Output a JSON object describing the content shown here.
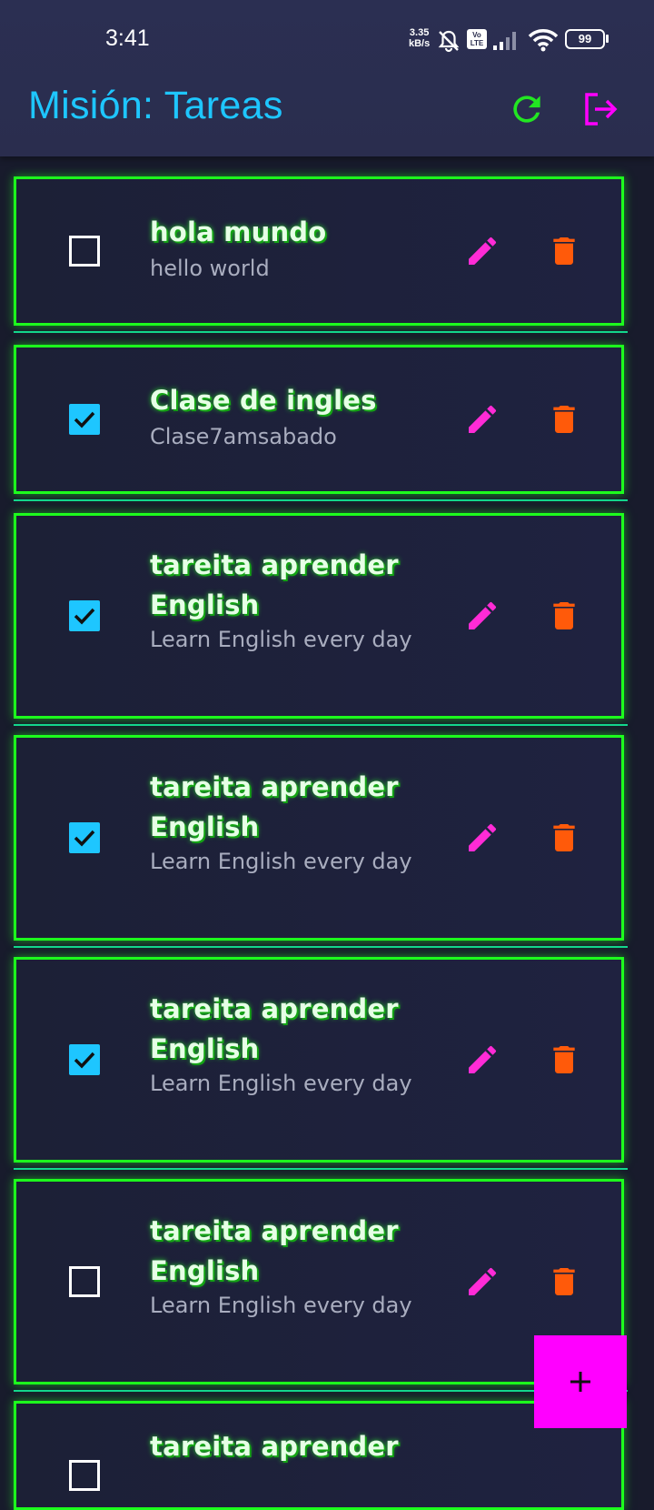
{
  "status_bar": {
    "time": "3:41",
    "net_speed_value": "3.35",
    "net_speed_unit": "kB/s",
    "volte": "Vo LTE",
    "battery": "99"
  },
  "app_bar": {
    "title": "Misión: Tareas",
    "refresh_icon": "refresh-icon",
    "logout_icon": "logout-icon",
    "colors": {
      "title": "#1ec6ff",
      "refresh": "#22e622",
      "logout": "#ff00ff"
    }
  },
  "tasks": [
    {
      "title": "hola mundo",
      "description": "hello world",
      "done": false
    },
    {
      "title": "Clase de ingles",
      "description": "Clase7amsabado",
      "done": true
    },
    {
      "title": "tareita aprender English",
      "description": "Learn English every day",
      "done": true
    },
    {
      "title": "tareita aprender English",
      "description": "Learn English every day",
      "done": true
    },
    {
      "title": "tareita aprender English",
      "description": "Learn English every day",
      "done": true
    },
    {
      "title": "tareita aprender English",
      "description": "Learn English every day",
      "done": false
    },
    {
      "title": "tareita aprender",
      "description": "",
      "done": false
    }
  ],
  "task_actions": {
    "edit_icon": "edit-icon",
    "delete_icon": "trash-icon"
  },
  "fab": {
    "label": "+",
    "icon": "plus-icon"
  },
  "colors": {
    "card_border": "#1dff1d",
    "checkbox_checked": "#1ec6ff",
    "edit": "#ff2bd6",
    "delete": "#ff5a0a",
    "fab": "#ff00ff"
  }
}
